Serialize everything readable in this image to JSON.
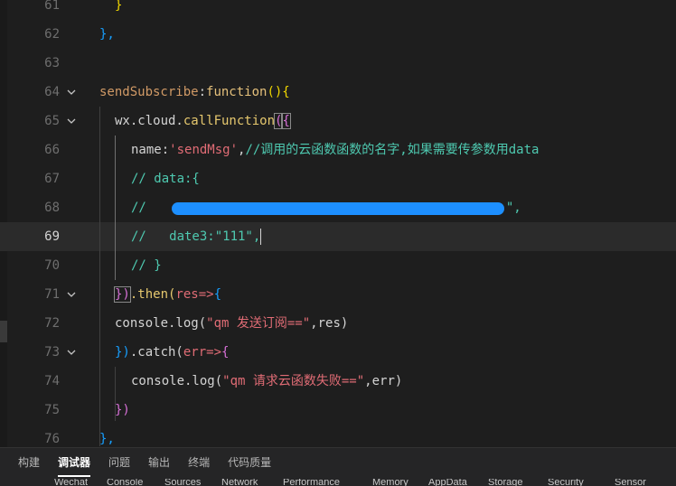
{
  "editor": {
    "current_line": 69,
    "lines": [
      {
        "num": "61",
        "fold": false
      },
      {
        "num": "62",
        "fold": false
      },
      {
        "num": "63",
        "fold": false
      },
      {
        "num": "64",
        "fold": true
      },
      {
        "num": "65",
        "fold": true
      },
      {
        "num": "66",
        "fold": false
      },
      {
        "num": "67",
        "fold": false
      },
      {
        "num": "68",
        "fold": false
      },
      {
        "num": "69",
        "fold": false
      },
      {
        "num": "70",
        "fold": false
      },
      {
        "num": "71",
        "fold": true
      },
      {
        "num": "72",
        "fold": false
      },
      {
        "num": "73",
        "fold": true
      },
      {
        "num": "74",
        "fold": false
      },
      {
        "num": "75",
        "fold": false
      },
      {
        "num": "76",
        "fold": false
      }
    ],
    "code": {
      "l61": "}",
      "l62": "},",
      "l64_name": "sendSubscribe",
      "l64_colon": ":",
      "l64_kw": "function",
      "l64_rest": "(){",
      "l65_obj": "wx.cloud.",
      "l65_fn": "callFunction",
      "l65_paren": "(",
      "l65_brace": "{",
      "l66_key": "name",
      "l66_colon": ":",
      "l66_str": "'sendMsg'",
      "l66_comma": ",",
      "l66_comment": "//调用的云函数函数的名字,如果需要传参数用data",
      "l67": "// data:{",
      "l68_a": "//",
      "l68_b": "\",",
      "l69": "//   date3:\"111\",",
      "l70": "// }",
      "l71_a": "})",
      "l71_b": ".then(",
      "l71_c": "res=>",
      "l71_d": "{",
      "l72_a": "console.log(",
      "l72_str": "\"qm 发送订阅==\"",
      "l72_b": ",res)",
      "l73_a": "})",
      "l73_b": ".catch(",
      "l73_c": "err=>",
      "l73_d": "{",
      "l74_a": "console.log(",
      "l74_str": "\"qm 请求云函数失败==\"",
      "l74_b": ",err)",
      "l75": "})",
      "l76": "},"
    }
  },
  "panel": {
    "tabs": [
      "构建",
      "调试器",
      "问题",
      "输出",
      "终端",
      "代码质量"
    ],
    "active_tab": "调试器",
    "subtabs": [
      "Wechat",
      "Console",
      "Sources",
      "Network",
      "Performance",
      "Memory",
      "AppData",
      "Storage",
      "Security",
      "Sensor"
    ]
  },
  "colors": {
    "background": "#1e1e1e",
    "current_line": "#2b2b2b",
    "comment": "#4ec9b0",
    "string": "#e0a94f",
    "redaction": "#1d8fff"
  }
}
